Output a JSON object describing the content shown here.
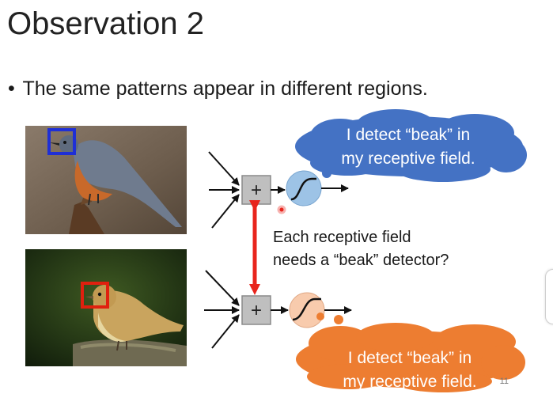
{
  "slide": {
    "title": "Observation 2",
    "bullet_symbol": "•",
    "bullet": "The same patterns appear in different regions.",
    "note_line1": "Each receptive field",
    "note_line2": "needs a “beak” detector?",
    "cloud_top_line1": "I detect “beak” in",
    "cloud_top_line2": "my receptive field.",
    "cloud_bottom_line1": "I detect “beak” in",
    "cloud_bottom_line2": "my receptive field.",
    "plus_symbol": "+",
    "page_number": "11"
  },
  "colors": {
    "cloud_top": "#4472c4",
    "cloud_bottom": "#ed7d31",
    "neuron_top": "#9dc3e6",
    "neuron_bottom": "#f8cbad",
    "box_top": "#1f2fd6",
    "box_bottom": "#e0200f",
    "arrow": "#e8241c"
  }
}
